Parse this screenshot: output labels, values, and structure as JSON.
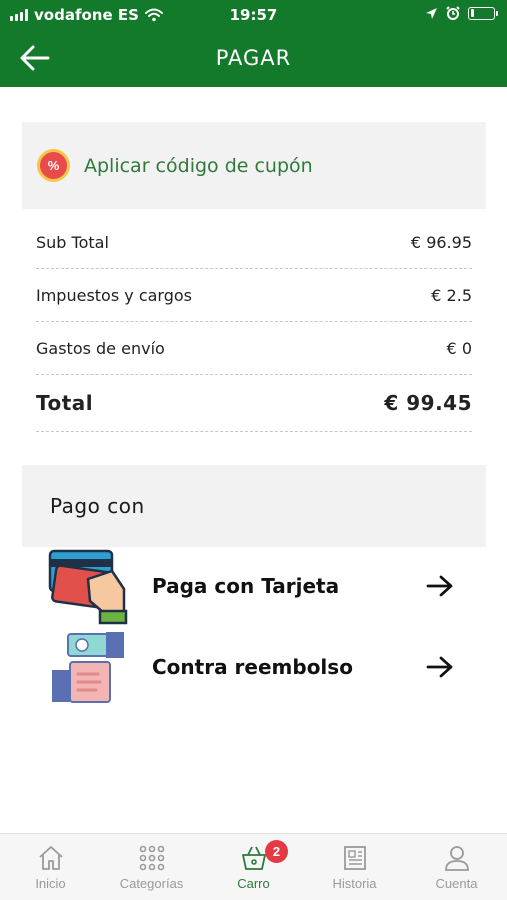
{
  "status_bar": {
    "carrier": "vodafone ES",
    "time": "19:57",
    "icons": [
      "signal-icon",
      "wifi-icon",
      "location-icon",
      "alarm-icon",
      "battery-icon"
    ],
    "battery_level": 0.15
  },
  "header": {
    "title": "PAGAR",
    "back_icon": "arrow-left-icon",
    "background_color": "#137a2c"
  },
  "coupon": {
    "icon": "discount-percent-icon",
    "icon_text": "%",
    "label": "Aplicar código de cupón"
  },
  "summary": {
    "rows": [
      {
        "label": "Sub Total",
        "value": "€ 96.95"
      },
      {
        "label": "Impuestos y cargos",
        "value": "€ 2.5"
      },
      {
        "label": "Gastos de envío",
        "value": "€ 0"
      }
    ],
    "total": {
      "label": "Total",
      "value": "€ 99.45"
    }
  },
  "payment": {
    "title": "Pago con",
    "options": [
      {
        "label": "Paga con Tarjeta",
        "icon": "credit-card-hand-icon",
        "arrow_icon": "arrow-right-icon"
      },
      {
        "label": "Contra reembolso",
        "icon": "cash-hand-icon",
        "arrow_icon": "arrow-right-icon"
      }
    ]
  },
  "tabbar": {
    "active_color": "#2f7a3a",
    "tabs": [
      {
        "label": "Inicio",
        "icon": "home-icon",
        "active": false
      },
      {
        "label": "Categorías",
        "icon": "grid-dots-icon",
        "active": false
      },
      {
        "label": "Carro",
        "icon": "basket-icon",
        "active": true,
        "badge": "2"
      },
      {
        "label": "Historia",
        "icon": "newspaper-icon",
        "active": false
      },
      {
        "label": "Cuenta",
        "icon": "user-icon",
        "active": false
      }
    ]
  }
}
